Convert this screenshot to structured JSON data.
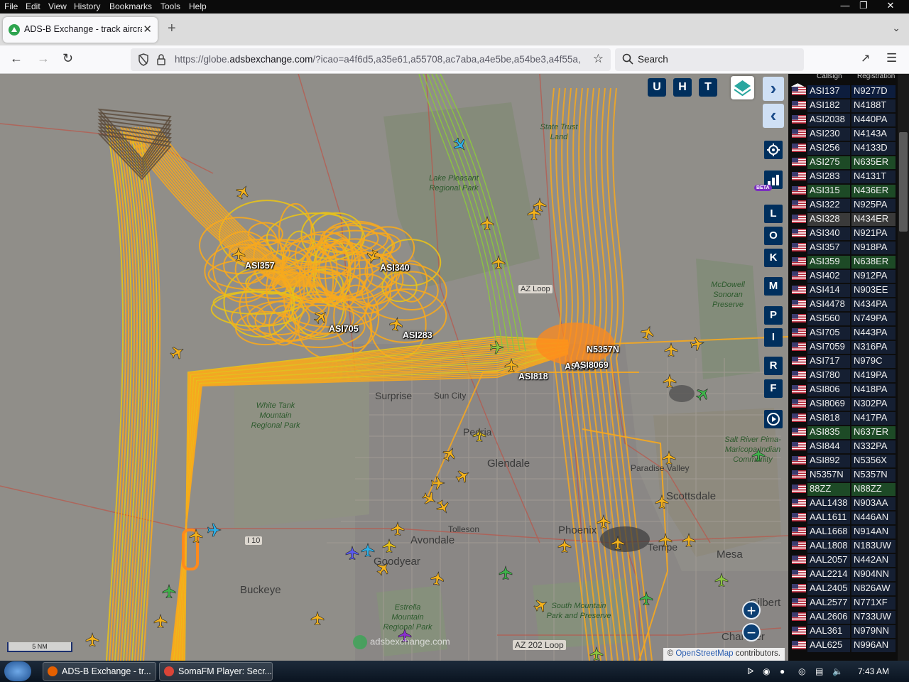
{
  "menubar": {
    "items": [
      "File",
      "Edit",
      "View",
      "History",
      "Bookmarks",
      "Tools",
      "Help"
    ],
    "window_controls": [
      "minimize",
      "restore",
      "close"
    ]
  },
  "browser": {
    "tab_title": "ADS-B Exchange - track aircraft",
    "url_prefix": "https://globe.",
    "url_domain": "adsbexchange.com",
    "url_rest": "/?icao=a4f6d5,a35e61,a55708,ac7aba,a4e5be,a54be3,a4f55a,",
    "search_placeholder": "Search"
  },
  "map": {
    "top_buttons": [
      "U",
      "H",
      "T"
    ],
    "side_buttons": [
      "L",
      "O",
      "K",
      "M",
      "P",
      "I",
      "R",
      "F"
    ],
    "beta_label": "BETA",
    "places": [
      {
        "name": "Surprise"
      },
      {
        "name": "Sun City"
      },
      {
        "name": "Glendale"
      },
      {
        "name": "Peoria"
      },
      {
        "name": "Tolleson"
      },
      {
        "name": "Buckeye"
      },
      {
        "name": "Goodyear"
      },
      {
        "name": "Avondale"
      },
      {
        "name": "Phoenix"
      },
      {
        "name": "Scottsdale"
      },
      {
        "name": "Tempe"
      },
      {
        "name": "Mesa"
      },
      {
        "name": "Gilbert"
      },
      {
        "name": "Chandler"
      },
      {
        "name": "Paradise Valley"
      }
    ],
    "parks": [
      {
        "name": "White Tank Mountain Regional Park"
      },
      {
        "name": "Estrella Mountain Regional Park"
      },
      {
        "name": "South Mountain Park and Preserve"
      },
      {
        "name": "McDowell Sonoran Preserve"
      },
      {
        "name": "Salt River Pima-Maricopa Indian Community"
      },
      {
        "name": "State Trust Land"
      },
      {
        "name": "Lake Pleasant Regional Park"
      }
    ],
    "highways": [
      "I 10",
      "AZ 202 Loop",
      "AZ Loop"
    ],
    "aircraft_labels": [
      "ASI357",
      "ASI340",
      "ASI705",
      "ASI283",
      "ASI818",
      "N5357N",
      "ASI256",
      "ASI8069"
    ],
    "scale_text": "5 NM",
    "watermark": "adsbexchange.com",
    "attribution_prefix": "© ",
    "attribution_link": "OpenStreetMap",
    "attribution_suffix": " contributors.",
    "track_colors": {
      "primary": "#f7a81e",
      "secondary": "#e8c21a",
      "green": "#8cc63f",
      "hot": "#ff8a1c"
    }
  },
  "panel": {
    "col_callsign": "Callsign",
    "col_registration": "Registration",
    "rows": [
      {
        "callsign": "ASI137",
        "reg": "N9277D",
        "style": "blue"
      },
      {
        "callsign": "ASI182",
        "reg": "N4188T",
        "style": "dark"
      },
      {
        "callsign": "ASI2038",
        "reg": "N440PA",
        "style": "dark"
      },
      {
        "callsign": "ASI230",
        "reg": "N4143A",
        "style": "dark"
      },
      {
        "callsign": "ASI256",
        "reg": "N4133D",
        "style": "dark"
      },
      {
        "callsign": "ASI275",
        "reg": "N635ER",
        "style": "green"
      },
      {
        "callsign": "ASI283",
        "reg": "N4131T",
        "style": "dark"
      },
      {
        "callsign": "ASI315",
        "reg": "N436ER",
        "style": "green"
      },
      {
        "callsign": "ASI322",
        "reg": "N925PA",
        "style": "dark"
      },
      {
        "callsign": "ASI328",
        "reg": "N434ER",
        "style": "grey"
      },
      {
        "callsign": "ASI340",
        "reg": "N921PA",
        "style": "dark"
      },
      {
        "callsign": "ASI357",
        "reg": "N918PA",
        "style": "dark"
      },
      {
        "callsign": "ASI359",
        "reg": "N638ER",
        "style": "green"
      },
      {
        "callsign": "ASI402",
        "reg": "N912PA",
        "style": "dark"
      },
      {
        "callsign": "ASI414",
        "reg": "N903EE",
        "style": "dark"
      },
      {
        "callsign": "ASI4478",
        "reg": "N434PA",
        "style": "dark"
      },
      {
        "callsign": "ASI560",
        "reg": "N749PA",
        "style": "dark"
      },
      {
        "callsign": "ASI705",
        "reg": "N443PA",
        "style": "dark"
      },
      {
        "callsign": "ASI7059",
        "reg": "N316PA",
        "style": "dark"
      },
      {
        "callsign": "ASI717",
        "reg": "N979C",
        "style": "dark"
      },
      {
        "callsign": "ASI780",
        "reg": "N419PA",
        "style": "dark"
      },
      {
        "callsign": "ASI806",
        "reg": "N418PA",
        "style": "dark"
      },
      {
        "callsign": "ASI8069",
        "reg": "N302PA",
        "style": "dark"
      },
      {
        "callsign": "ASI818",
        "reg": "N417PA",
        "style": "dark"
      },
      {
        "callsign": "ASI835",
        "reg": "N637ER",
        "style": "green"
      },
      {
        "callsign": "ASI844",
        "reg": "N332PA",
        "style": "dark"
      },
      {
        "callsign": "ASI892",
        "reg": "N5356X",
        "style": "dark"
      },
      {
        "callsign": "N5357N",
        "reg": "N5357N",
        "style": "dark"
      },
      {
        "callsign": "88ZZ",
        "reg": "N88ZZ",
        "style": "green"
      },
      {
        "callsign": "AAL1438",
        "reg": "N903AA",
        "style": "dark"
      },
      {
        "callsign": "AAL1611",
        "reg": "N446AN",
        "style": "dark"
      },
      {
        "callsign": "AAL1668",
        "reg": "N914AN",
        "style": "dark"
      },
      {
        "callsign": "AAL1808",
        "reg": "N183UW",
        "style": "dark"
      },
      {
        "callsign": "AAL2057",
        "reg": "N442AN",
        "style": "dark"
      },
      {
        "callsign": "AAL2214",
        "reg": "N904NN",
        "style": "dark"
      },
      {
        "callsign": "AAL2405",
        "reg": "N826AW",
        "style": "dark"
      },
      {
        "callsign": "AAL2577",
        "reg": "N771XF",
        "style": "dark"
      },
      {
        "callsign": "AAL2606",
        "reg": "N733UW",
        "style": "dark"
      },
      {
        "callsign": "AAL361",
        "reg": "N979NN",
        "style": "dark"
      },
      {
        "callsign": "AAL625",
        "reg": "N996AN",
        "style": "dark"
      }
    ]
  },
  "taskbar": {
    "items": [
      "ADS-B Exchange - tr...",
      "SomaFM Player: Secr..."
    ],
    "clock": "7:43 AM"
  }
}
